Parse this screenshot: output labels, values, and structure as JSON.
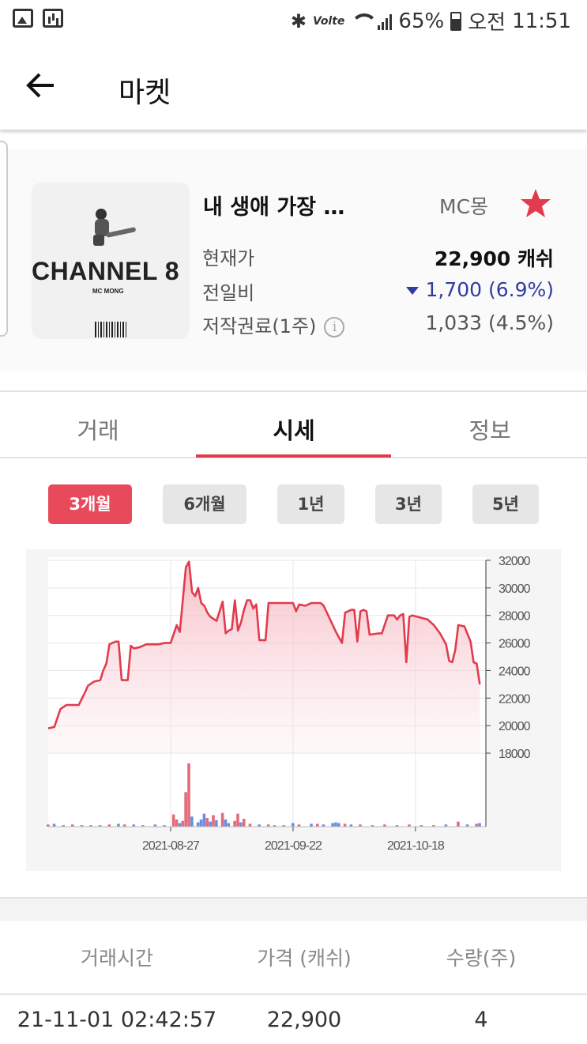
{
  "status_bar": {
    "battery_percent": "65%",
    "ampm": "오전",
    "time": "11:51",
    "network_label": "Volte",
    "left_icons": [
      "image-icon",
      "stats-icon"
    ]
  },
  "app_bar": {
    "title": "마켓",
    "back_icon": "back-arrow-icon"
  },
  "song": {
    "album_cover_text": "CHANNEL 8",
    "album_cover_subtext": "MC MONG",
    "title": "내 생애 가장 …",
    "artist": "MC몽",
    "favorite": true,
    "rows": {
      "current_price_label": "현재가",
      "current_price_value": "22,900 캐쉬",
      "change_label": "전일비",
      "change_value": "1,700 (6.9%)",
      "change_direction": "down",
      "royalty_label": "저작권료(1주)",
      "royalty_value": "1,033 (4.5%)"
    }
  },
  "tabs": [
    {
      "label": "거래",
      "active": false
    },
    {
      "label": "시세",
      "active": true
    },
    {
      "label": "정보",
      "active": false
    }
  ],
  "periods": [
    {
      "label": "3개월",
      "active": true
    },
    {
      "label": "6개월",
      "active": false
    },
    {
      "label": "1년",
      "active": false
    },
    {
      "label": "3년",
      "active": false
    },
    {
      "label": "5년",
      "active": false
    }
  ],
  "colors": {
    "accent": "#e23b4e",
    "price_down": "#2f3e9e",
    "volume_up": "#e36b7a",
    "volume_down": "#6b8fe0"
  },
  "chart_data": {
    "type": "line",
    "title": "",
    "y_ticks": [
      "32000",
      "30000",
      "28000",
      "26000",
      "24000",
      "22000",
      "20000",
      "18000"
    ],
    "ylim": [
      18000,
      32000
    ],
    "x_tick_labels": [
      {
        "label": "2021-08-27",
        "index": 40
      },
      {
        "label": "2021-09-22",
        "index": 80
      },
      {
        "label": "2021-10-18",
        "index": 120
      }
    ],
    "num_points": 144,
    "price_series": {
      "name": "",
      "points": [
        [
          0,
          19800
        ],
        [
          2,
          19900
        ],
        [
          4,
          21200
        ],
        [
          6,
          21500
        ],
        [
          9,
          21500
        ],
        [
          10,
          21500
        ],
        [
          12,
          22400
        ],
        [
          13,
          22900
        ],
        [
          15,
          23200
        ],
        [
          17,
          23300
        ],
        [
          18,
          24000
        ],
        [
          19,
          24500
        ],
        [
          20,
          25900
        ],
        [
          22,
          26100
        ],
        [
          23,
          26100
        ],
        [
          24,
          23300
        ],
        [
          26,
          23300
        ],
        [
          27,
          25800
        ],
        [
          28,
          25600
        ],
        [
          30,
          25700
        ],
        [
          32,
          25900
        ],
        [
          34,
          25900
        ],
        [
          36,
          25900
        ],
        [
          38,
          26000
        ],
        [
          40,
          26000
        ],
        [
          42,
          27300
        ],
        [
          43,
          26800
        ],
        [
          45,
          31500
        ],
        [
          46,
          31900
        ],
        [
          47,
          29700
        ],
        [
          48,
          29400
        ],
        [
          49,
          30000
        ],
        [
          50,
          28900
        ],
        [
          51,
          28700
        ],
        [
          52,
          28200
        ],
        [
          53,
          27900
        ],
        [
          55,
          27600
        ],
        [
          57,
          29000
        ],
        [
          58,
          26700
        ],
        [
          59,
          26900
        ],
        [
          60,
          27000
        ],
        [
          61,
          29100
        ],
        [
          62,
          26900
        ],
        [
          63,
          27500
        ],
        [
          64,
          28400
        ],
        [
          65,
          29100
        ],
        [
          66,
          29100
        ],
        [
          67,
          28500
        ],
        [
          68,
          28800
        ],
        [
          69,
          26200
        ],
        [
          71,
          26200
        ],
        [
          72,
          28900
        ],
        [
          75,
          28900
        ],
        [
          80,
          28900
        ],
        [
          81,
          28300
        ],
        [
          82,
          28800
        ],
        [
          84,
          28700
        ],
        [
          86,
          28900
        ],
        [
          88,
          28900
        ],
        [
          89,
          28900
        ],
        [
          90,
          28700
        ],
        [
          94,
          26800
        ],
        [
          96,
          26000
        ],
        [
          97,
          28200
        ],
        [
          99,
          28400
        ],
        [
          100,
          28400
        ],
        [
          101,
          26100
        ],
        [
          102,
          28300
        ],
        [
          103,
          28400
        ],
        [
          104,
          28300
        ],
        [
          105,
          26600
        ],
        [
          108,
          26700
        ],
        [
          109,
          26700
        ],
        [
          111,
          28000
        ],
        [
          113,
          28000
        ],
        [
          114,
          27700
        ],
        [
          115,
          28000
        ],
        [
          116,
          28100
        ],
        [
          117,
          24600
        ],
        [
          118,
          27900
        ],
        [
          119,
          28000
        ],
        [
          124,
          27700
        ],
        [
          126,
          27300
        ],
        [
          128,
          26700
        ],
        [
          130,
          25900
        ],
        [
          131,
          24700
        ],
        [
          132,
          24600
        ],
        [
          133,
          25500
        ],
        [
          134,
          27300
        ],
        [
          136,
          27200
        ],
        [
          138,
          26100
        ],
        [
          139,
          24600
        ],
        [
          140,
          24500
        ],
        [
          141,
          23000
        ]
      ]
    },
    "volume_series": [
      {
        "index": 0,
        "value": 3,
        "dir": "up"
      },
      {
        "index": 2,
        "value": 4,
        "dir": "down"
      },
      {
        "index": 5,
        "value": 2,
        "dir": "down"
      },
      {
        "index": 8,
        "value": 3,
        "dir": "up"
      },
      {
        "index": 11,
        "value": 2,
        "dir": "down"
      },
      {
        "index": 14,
        "value": 2,
        "dir": "up"
      },
      {
        "index": 17,
        "value": 2,
        "dir": "down"
      },
      {
        "index": 20,
        "value": 3,
        "dir": "up"
      },
      {
        "index": 23,
        "value": 4,
        "dir": "down"
      },
      {
        "index": 25,
        "value": 3,
        "dir": "up"
      },
      {
        "index": 28,
        "value": 3,
        "dir": "down"
      },
      {
        "index": 31,
        "value": 2,
        "dir": "up"
      },
      {
        "index": 35,
        "value": 3,
        "dir": "down"
      },
      {
        "index": 38,
        "value": 2,
        "dir": "down"
      },
      {
        "index": 41,
        "value": 17,
        "dir": "up"
      },
      {
        "index": 42,
        "value": 10,
        "dir": "up"
      },
      {
        "index": 43,
        "value": 5,
        "dir": "down"
      },
      {
        "index": 44,
        "value": 8,
        "dir": "up"
      },
      {
        "index": 45,
        "value": 48,
        "dir": "up"
      },
      {
        "index": 46,
        "value": 88,
        "dir": "up"
      },
      {
        "index": 47,
        "value": 14,
        "dir": "down"
      },
      {
        "index": 49,
        "value": 6,
        "dir": "down"
      },
      {
        "index": 50,
        "value": 10,
        "dir": "down"
      },
      {
        "index": 51,
        "value": 18,
        "dir": "down"
      },
      {
        "index": 52,
        "value": 12,
        "dir": "up"
      },
      {
        "index": 53,
        "value": 7,
        "dir": "down"
      },
      {
        "index": 54,
        "value": 16,
        "dir": "up"
      },
      {
        "index": 55,
        "value": 9,
        "dir": "down"
      },
      {
        "index": 57,
        "value": 19,
        "dir": "up"
      },
      {
        "index": 58,
        "value": 10,
        "dir": "down"
      },
      {
        "index": 59,
        "value": 5,
        "dir": "down"
      },
      {
        "index": 61,
        "value": 8,
        "dir": "up"
      },
      {
        "index": 62,
        "value": 18,
        "dir": "up"
      },
      {
        "index": 63,
        "value": 6,
        "dir": "down"
      },
      {
        "index": 64,
        "value": 11,
        "dir": "up"
      },
      {
        "index": 66,
        "value": 4,
        "dir": "up"
      },
      {
        "index": 69,
        "value": 3,
        "dir": "down"
      },
      {
        "index": 72,
        "value": 3,
        "dir": "up"
      },
      {
        "index": 74,
        "value": 2,
        "dir": "up"
      },
      {
        "index": 77,
        "value": 2,
        "dir": "down"
      },
      {
        "index": 80,
        "value": 5,
        "dir": "down"
      },
      {
        "index": 82,
        "value": 3,
        "dir": "up"
      },
      {
        "index": 86,
        "value": 4,
        "dir": "down"
      },
      {
        "index": 88,
        "value": 4,
        "dir": "up"
      },
      {
        "index": 90,
        "value": 3,
        "dir": "down"
      },
      {
        "index": 93,
        "value": 5,
        "dir": "down"
      },
      {
        "index": 94,
        "value": 6,
        "dir": "down"
      },
      {
        "index": 95,
        "value": 5,
        "dir": "down"
      },
      {
        "index": 97,
        "value": 4,
        "dir": "up"
      },
      {
        "index": 99,
        "value": 3,
        "dir": "down"
      },
      {
        "index": 102,
        "value": 3,
        "dir": "up"
      },
      {
        "index": 106,
        "value": 2,
        "dir": "down"
      },
      {
        "index": 110,
        "value": 3,
        "dir": "up"
      },
      {
        "index": 114,
        "value": 2,
        "dir": "down"
      },
      {
        "index": 118,
        "value": 3,
        "dir": "up"
      },
      {
        "index": 122,
        "value": 2,
        "dir": "down"
      },
      {
        "index": 126,
        "value": 2,
        "dir": "up"
      },
      {
        "index": 130,
        "value": 3,
        "dir": "down"
      },
      {
        "index": 134,
        "value": 7,
        "dir": "up"
      },
      {
        "index": 137,
        "value": 3,
        "dir": "down"
      },
      {
        "index": 140,
        "value": 4,
        "dir": "up"
      },
      {
        "index": 141,
        "value": 5,
        "dir": "down"
      }
    ]
  },
  "trade_table": {
    "headers": [
      "거래시간",
      "가격 (캐쉬)",
      "수량(주)"
    ],
    "rows": [
      [
        "21-11-01 02:42:57",
        "22,900",
        "4"
      ]
    ]
  }
}
